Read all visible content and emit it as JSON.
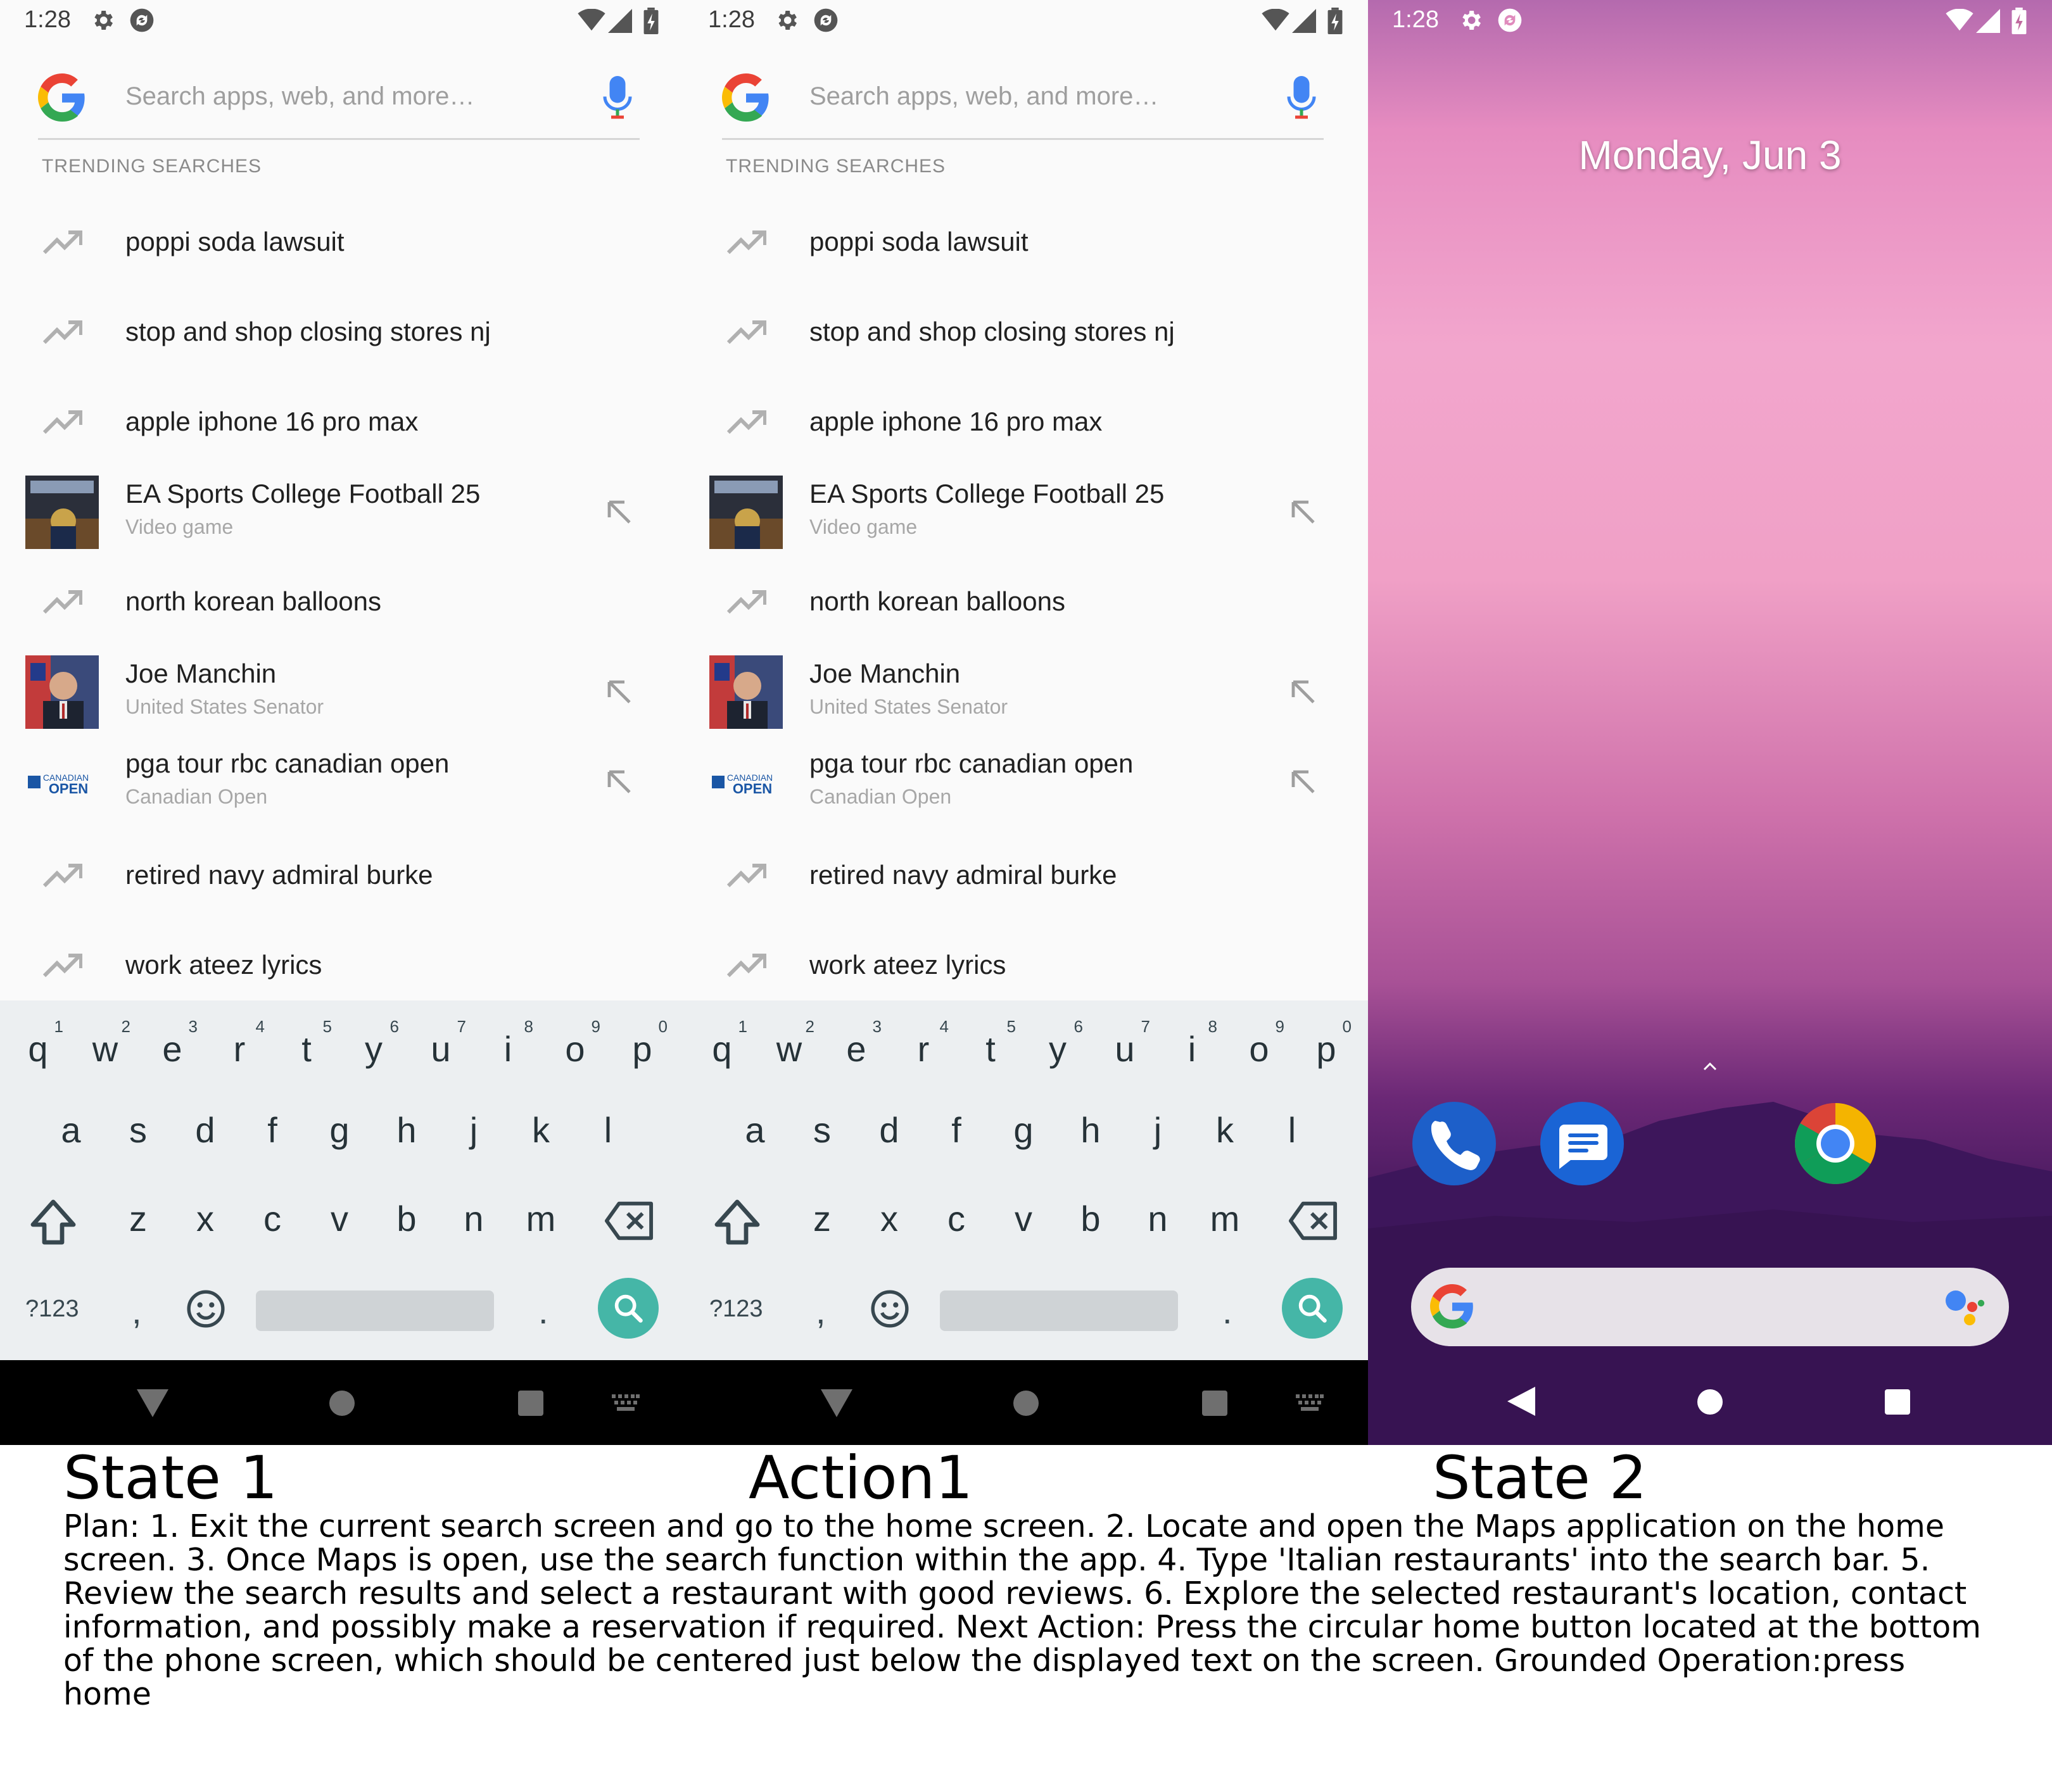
{
  "status": {
    "time": "1:28"
  },
  "search": {
    "placeholder": "Search apps, web, and more…",
    "trending_header": "TRENDING SEARCHES",
    "suggestions": [
      {
        "title": "poppi soda lawsuit",
        "subtitle": "",
        "kind": "trend"
      },
      {
        "title": "stop and shop closing stores nj",
        "subtitle": "",
        "kind": "trend"
      },
      {
        "title": "apple iphone 16 pro max",
        "subtitle": "",
        "kind": "trend"
      },
      {
        "title": "EA Sports College Football 25",
        "subtitle": "Video game",
        "kind": "entity"
      },
      {
        "title": "north korean balloons",
        "subtitle": "",
        "kind": "trend"
      },
      {
        "title": "Joe Manchin",
        "subtitle": "United States Senator",
        "kind": "entity"
      },
      {
        "title": "pga tour rbc canadian open",
        "subtitle": "Canadian Open",
        "kind": "entity"
      },
      {
        "title": "retired navy admiral burke",
        "subtitle": "",
        "kind": "trend"
      },
      {
        "title": "work ateez lyrics",
        "subtitle": "",
        "kind": "trend"
      }
    ]
  },
  "keyboard": {
    "row1": [
      {
        "k": "q",
        "h": "1"
      },
      {
        "k": "w",
        "h": "2"
      },
      {
        "k": "e",
        "h": "3"
      },
      {
        "k": "r",
        "h": "4"
      },
      {
        "k": "t",
        "h": "5"
      },
      {
        "k": "y",
        "h": "6"
      },
      {
        "k": "u",
        "h": "7"
      },
      {
        "k": "i",
        "h": "8"
      },
      {
        "k": "o",
        "h": "9"
      },
      {
        "k": "p",
        "h": "0"
      }
    ],
    "row2": [
      "a",
      "s",
      "d",
      "f",
      "g",
      "h",
      "j",
      "k",
      "l"
    ],
    "row3": [
      "z",
      "x",
      "c",
      "v",
      "b",
      "n",
      "m"
    ],
    "symbols_label": "?123",
    "comma": ",",
    "period": "."
  },
  "logo_text": {
    "canadian_open": "CANADIAN OPEN"
  },
  "home": {
    "date": "Monday, Jun 3"
  },
  "captions": {
    "state1": "State 1",
    "action1": "Action1",
    "state2": "State 2",
    "plan": "Plan: 1. Exit the current search screen and go to the home screen. 2. Locate and open the Maps application on the home screen. 3. Once Maps is open, use the search function within the app. 4. Type 'Italian restaurants' into the search bar. 5. Review the search results and select a restaurant with good reviews. 6. Explore the selected restaurant's location, contact information, and possibly make a reservation if required. Next Action: Press the circular home button located at the bottom of the phone screen, which should be centered just below the displayed text on the screen. Grounded Operation:press home"
  },
  "colors": {
    "search_key": "#45b6a7",
    "keyboard_bg": "#eceff1",
    "home_gradient_top": "#f2a6cd",
    "home_gradient_bottom": "#32104c"
  }
}
